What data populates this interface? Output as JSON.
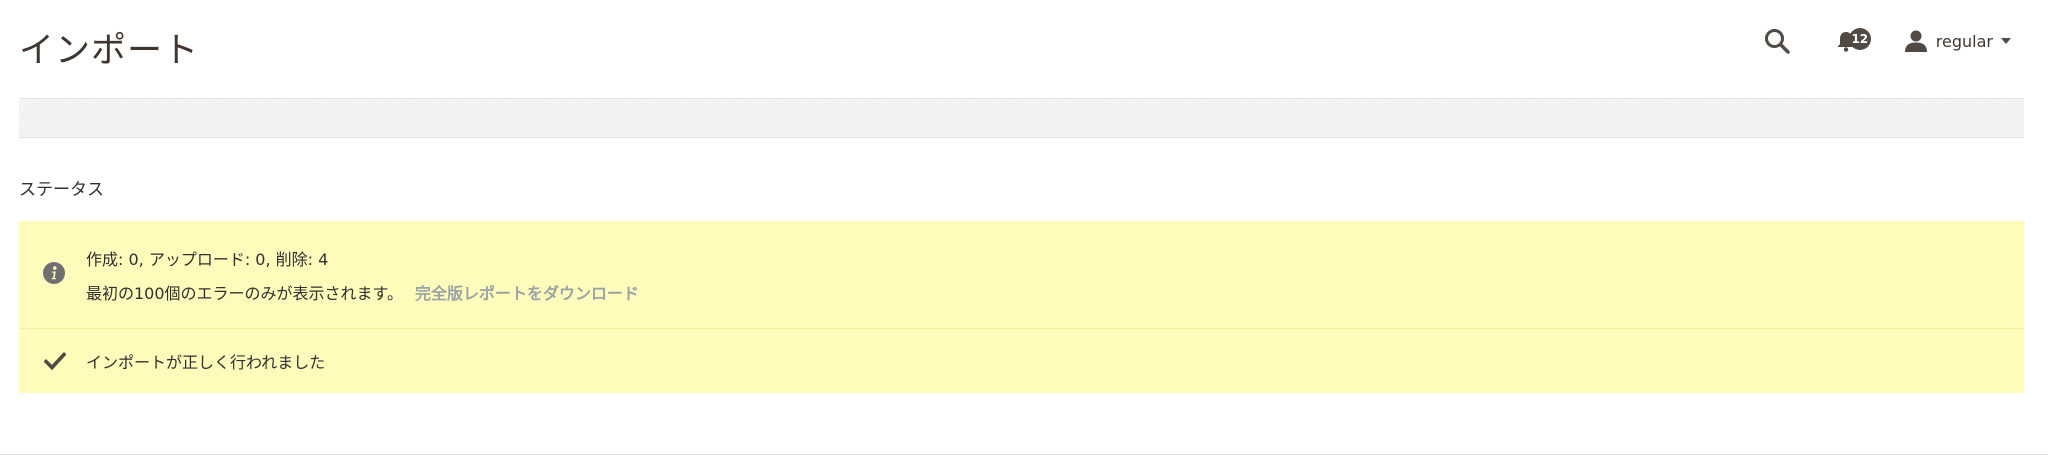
{
  "page": {
    "title": "インポート"
  },
  "header": {
    "search_icon": "search-icon",
    "notifications": {
      "icon": "bell-icon",
      "count": "12"
    },
    "user": {
      "icon": "user-icon",
      "name": "regular",
      "dropdown_icon": "caret-down-icon"
    }
  },
  "status_section": {
    "label": "ステータス",
    "info_message": {
      "icon": "info-icon",
      "summary": "作成: 0, アップロード: 0, 削除: 4",
      "errors_note": "最初の100個のエラーのみが表示されます。",
      "download_link": "完全版レポートをダウンロード"
    },
    "success_message": {
      "icon": "checkmark-icon",
      "text": "インポートが正しく行われました"
    }
  },
  "colors": {
    "message_background": "#fffbbb",
    "title_text": "#41362f",
    "link_text": "#9aa4a8",
    "badge_background": "#514943"
  }
}
